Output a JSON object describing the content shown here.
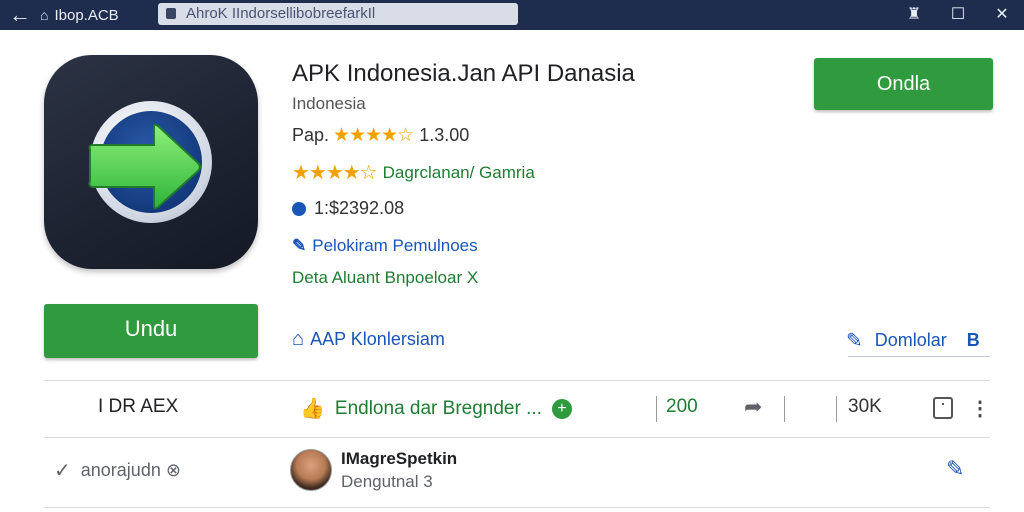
{
  "topbar": {
    "back": "←",
    "host": "Ibop.ACB",
    "url": "AhroK IIndorsellibobreefarkIl",
    "icons": [
      "home-icon",
      "lock-icon",
      "bookmark-icon",
      "window-icon",
      "close-icon"
    ]
  },
  "app": {
    "title": "APK Indonesia.Jan API Danasia",
    "developer": "Indonesia",
    "rating_prefix": "Pap.",
    "rating_stars": "★★★★☆",
    "rating_value": "1.3.00",
    "category_stars": "★★★★☆",
    "category": "Dagrclanan/ Gamria",
    "price": "1:$2392.08",
    "link_text": "Pelokiram Pemulnoes",
    "data_text": "Deta Aluant  Bnpoeloar X"
  },
  "buttons": {
    "top_install": "Ondla",
    "left_install": "Undu"
  },
  "actions": {
    "kl_label": "AAP Klonlersiam",
    "dl_label": "Domlolar",
    "dl_suffix": "B"
  },
  "stats": {
    "dr": "I DR AEX",
    "endorse": "Endlona dar Bregnder ...",
    "count": "200",
    "views": "30K"
  },
  "review": {
    "left_label": "anorajudn ⊗",
    "name": "IMagreSpetkin",
    "sub": "Dengutnal 3"
  },
  "colors": {
    "topbar": "#1e2c4e",
    "green_button": "#2f9a3e",
    "link_blue": "#1a55b8",
    "green_text": "#1e7d32",
    "star": "#f2a100"
  }
}
